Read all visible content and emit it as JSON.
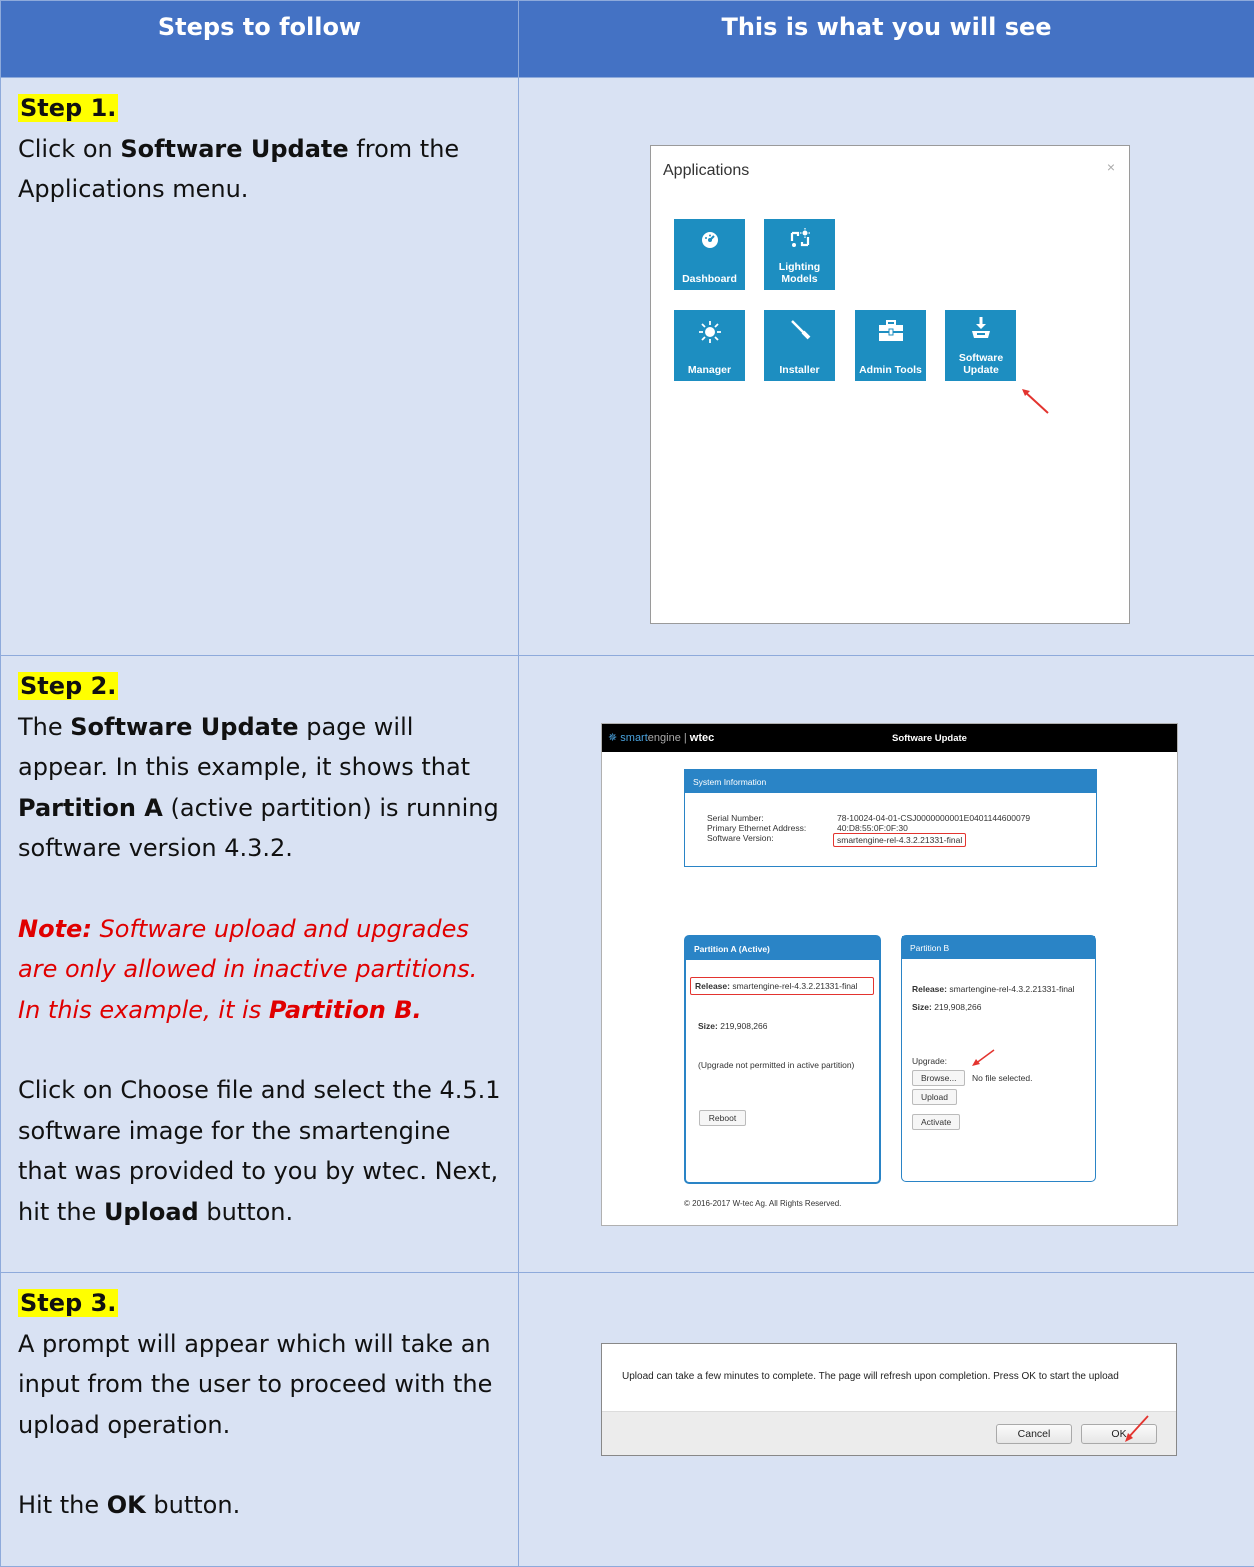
{
  "header": {
    "left": "Steps to follow",
    "right": "This is what you will see"
  },
  "step1": {
    "title": "Step 1.",
    "text_pre": "Click on ",
    "text_bold": "Software Update",
    "text_post": " from the Applications menu.",
    "dialog": {
      "title": "Applications",
      "close": "×",
      "tiles": [
        "Dashboard",
        "Lighting Models",
        "Manager",
        "Installer",
        "Admin Tools",
        "Software Update"
      ]
    }
  },
  "step2": {
    "title": "Step 2.",
    "p1_a": "The ",
    "p1_b": "Software Update",
    "p1_c": " page will appear. In this example, it shows that ",
    "p1_d": "Partition A",
    "p1_e": " (active partition) is running software version 4.3.2.",
    "note_label": "Note:",
    "note_text": " Software upload and upgrades are only allowed in inactive partitions. In this example, it is ",
    "note_bold": "Partition B.",
    "p3_a": "Click on Choose file and select the 4.5.1 software image for the smartengine that was provided to you by wtec. Next, hit the ",
    "p3_b": "Upload",
    "p3_c": " button.",
    "page": {
      "logo_a": "smart",
      "logo_b": "engine | ",
      "logo_c": "wtec",
      "bar_title": "Software Update",
      "sysinfo_title": "System Information",
      "serial_label": "Serial Number:",
      "serial_value": "78-10024-04-01-CSJ0000000001E0401144600079",
      "eth_label": "Primary Ethernet Address:",
      "eth_value": "40:D8:55:0F:0F:30",
      "ver_label": "Software Version:",
      "ver_value": "smartengine-rel-4.3.2.21331-final",
      "partA": {
        "title": "Partition A (Active)",
        "release_label": "Release:",
        "release_value": "smartengine-rel-4.3.2.21331-final",
        "size_label": "Size:",
        "size_value": "219,908,266",
        "note": "(Upgrade not permitted in active partition)",
        "reboot": "Reboot"
      },
      "partB": {
        "title": "Partition B",
        "release_label": "Release:",
        "release_value": "smartengine-rel-4.3.2.21331-final",
        "size_label": "Size:",
        "size_value": "219,908,266",
        "upgrade_label": "Upgrade:",
        "browse": "Browse...",
        "no_file": "No file selected.",
        "upload": "Upload",
        "activate": "Activate"
      },
      "footer": "© 2016-2017 W-tec Ag. All Rights Reserved."
    }
  },
  "step3": {
    "title": "Step 3.",
    "p1": "A prompt will appear which will take an input from the user to proceed with the upload operation.",
    "p2_a": "Hit the ",
    "p2_b": "OK",
    "p2_c": " button.",
    "prompt": {
      "message": "Upload can take a few minutes to complete. The page will refresh upon completion. Press OK to start the upload",
      "cancel": "Cancel",
      "ok": "OK"
    }
  },
  "colors": {
    "header_bg": "#4472c4",
    "cell_bg": "#d9e2f3",
    "tile": "#1d8ec1",
    "highlight": "#ffff00",
    "note": "#e00000",
    "annotation": "#e3342f"
  }
}
